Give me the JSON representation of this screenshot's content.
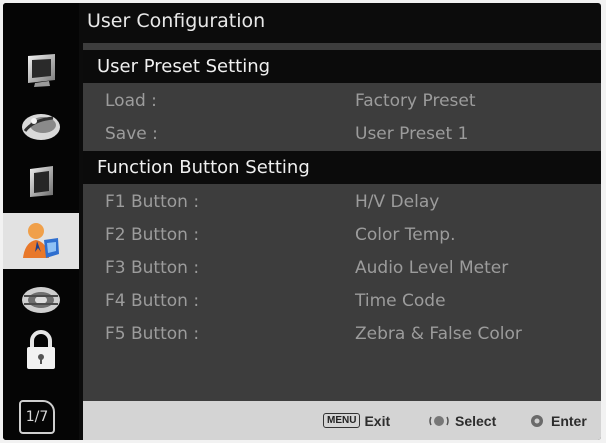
{
  "window": {
    "title": "User Configuration"
  },
  "sidebar": {
    "icons": [
      "monitor-icon",
      "color-palette-icon",
      "picture-icon",
      "user-icon",
      "settings-gear-icon",
      "lock-icon"
    ],
    "active_index": 3,
    "page_indicator": "1/7"
  },
  "sections": {
    "preset": {
      "header": "User Preset Setting",
      "rows": [
        {
          "label": "Load :",
          "value": "Factory Preset"
        },
        {
          "label": "Save :",
          "value": "User Preset 1"
        }
      ]
    },
    "function": {
      "header": "Function Button Setting",
      "rows": [
        {
          "label": "F1 Button :",
          "value": "H/V Delay"
        },
        {
          "label": "F2 Button :",
          "value": "Color Temp."
        },
        {
          "label": "F3 Button :",
          "value": "Audio Level Meter"
        },
        {
          "label": "F4 Button :",
          "value": "Time Code"
        },
        {
          "label": "F5 Button :",
          "value": "Zebra & False Color"
        }
      ]
    }
  },
  "footer": {
    "menu_key": "MENU",
    "exit_label": "Exit",
    "select_label": "Select",
    "enter_label": "Enter"
  },
  "colors": {
    "background": "#0c0c0c",
    "content_bg": "#3d3d3d",
    "header_bg": "#0b0b0b",
    "active_tab": "#e2e2e2",
    "footer_bg": "#d4d4d4"
  }
}
